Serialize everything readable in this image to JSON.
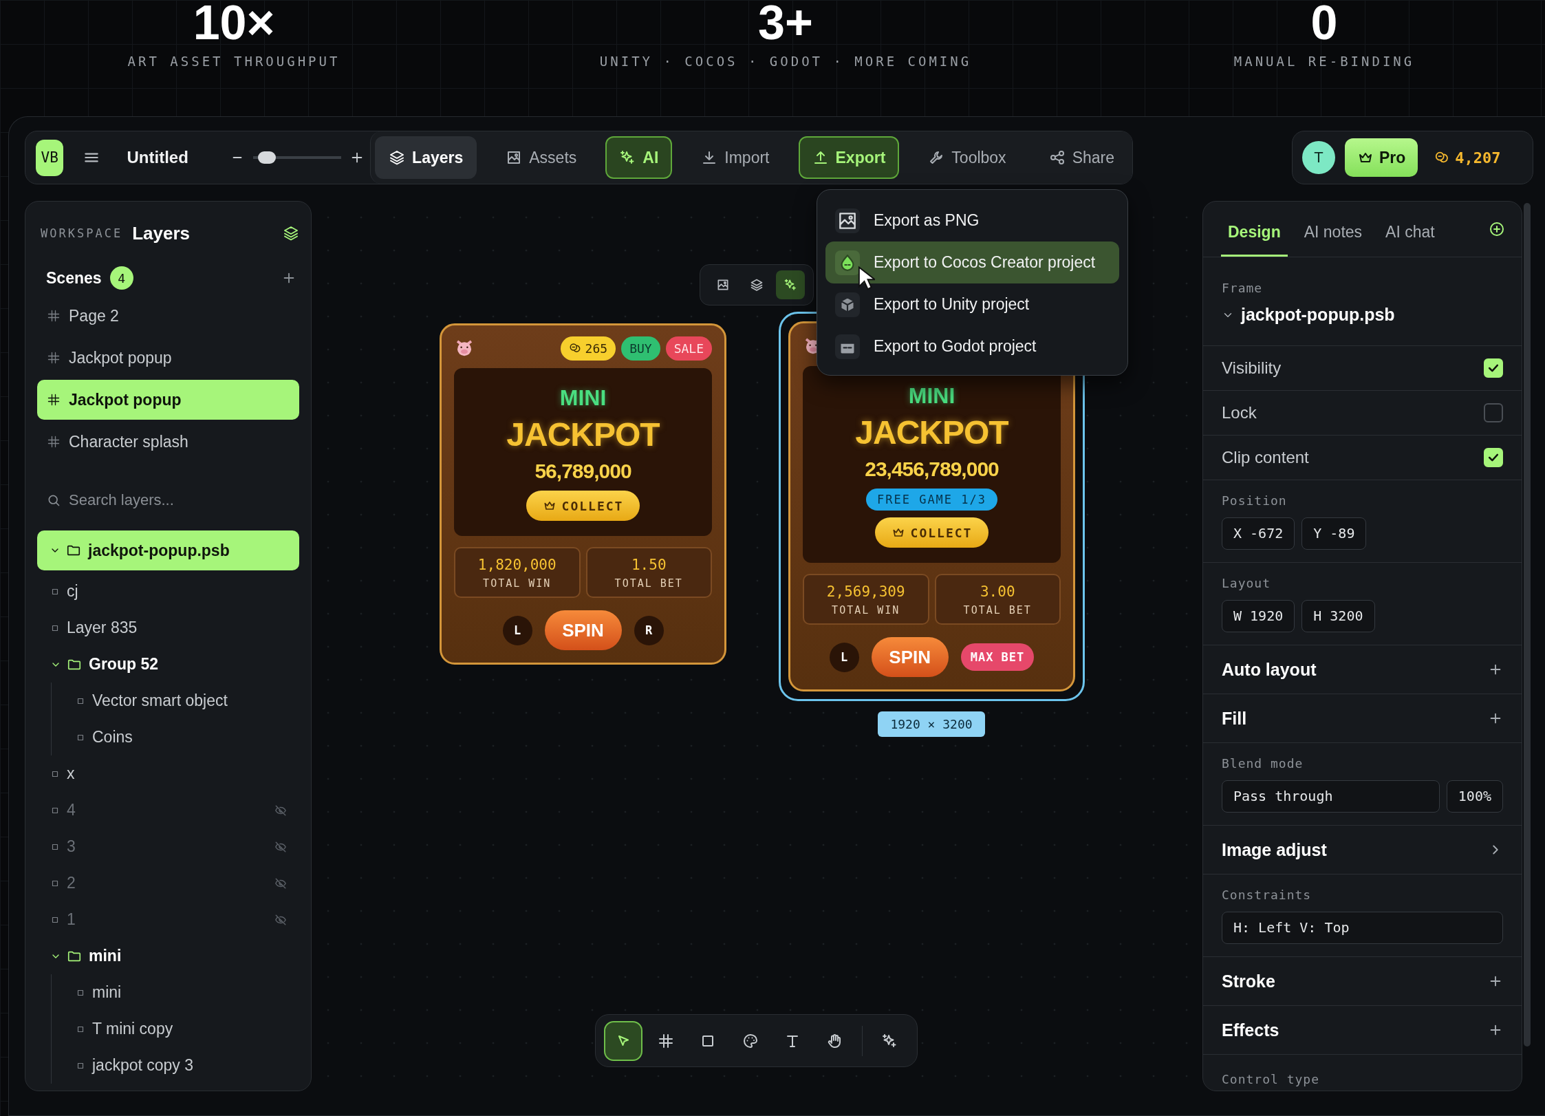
{
  "stats": [
    {
      "value": "10×",
      "label": "ART ASSET THROUGHPUT"
    },
    {
      "value": "3+",
      "label": "UNITY · COCOS · GODOT · MORE COMING"
    },
    {
      "value": "0",
      "label": "MANUAL RE-BINDING"
    }
  ],
  "toolbar": {
    "logo": "VB",
    "title": "Untitled",
    "zoom": {
      "level": 0.05
    },
    "tabs": [
      {
        "label": "Layers",
        "selected": true,
        "accent": false
      },
      {
        "label": "Assets",
        "selected": false,
        "accent": false
      },
      {
        "label": "AI",
        "selected": false,
        "accent": true
      },
      {
        "label": "Import",
        "selected": false,
        "accent": false
      },
      {
        "label": "Export",
        "selected": false,
        "accent": true
      },
      {
        "label": "Toolbox",
        "selected": false,
        "accent": false
      },
      {
        "label": "Share",
        "selected": false,
        "accent": false
      }
    ]
  },
  "account": {
    "avatar": "T",
    "plan": "Pro",
    "credits": "4,207"
  },
  "export_menu": {
    "items": [
      {
        "label": "Export as PNG",
        "selected": false
      },
      {
        "label": "Export to Cocos Creator project",
        "selected": true
      },
      {
        "label": "Export to Unity project",
        "selected": false
      },
      {
        "label": "Export to Godot project",
        "selected": false
      }
    ]
  },
  "left_panel": {
    "eyebrow": "WORKSPACE",
    "title": "Layers",
    "scenes": {
      "label": "Scenes",
      "count": "4",
      "items": [
        {
          "label": "Page 2",
          "selected": false
        },
        {
          "label": "Jackpot popup",
          "selected": false
        },
        {
          "label": "Jackpot popup",
          "selected": true
        },
        {
          "label": "Character splash",
          "selected": false
        }
      ]
    },
    "search": {
      "placeholder": "Search layers..."
    },
    "layers": [
      {
        "name": "jackpot-popup.psb",
        "kind": "folder",
        "expanded": true,
        "selected": true,
        "hidden": false,
        "children": [
          {
            "name": "cj",
            "kind": "layer",
            "selected": false,
            "hidden": false
          },
          {
            "name": "Layer 835",
            "kind": "layer",
            "selected": false,
            "hidden": false
          },
          {
            "name": "Group 52",
            "kind": "folder",
            "expanded": true,
            "selected": false,
            "hidden": false,
            "children": [
              {
                "name": "Vector smart object",
                "kind": "layer",
                "selected": false,
                "hidden": false
              },
              {
                "name": "Coins",
                "kind": "layer",
                "selected": false,
                "hidden": false
              }
            ]
          },
          {
            "name": "x",
            "kind": "layer",
            "selected": false,
            "hidden": false
          },
          {
            "name": "4",
            "kind": "layer",
            "selected": false,
            "hidden": true
          },
          {
            "name": "3",
            "kind": "layer",
            "selected": false,
            "hidden": true
          },
          {
            "name": "2",
            "kind": "layer",
            "selected": false,
            "hidden": true
          },
          {
            "name": "1",
            "kind": "layer",
            "selected": false,
            "hidden": true
          },
          {
            "name": "mini",
            "kind": "folder",
            "expanded": true,
            "selected": false,
            "hidden": false,
            "children": [
              {
                "name": "mini",
                "kind": "layer",
                "selected": false,
                "hidden": false
              },
              {
                "name": "T mini copy",
                "kind": "layer",
                "selected": false,
                "hidden": false
              },
              {
                "name": "jackpot copy 3",
                "kind": "layer",
                "selected": false,
                "hidden": false
              }
            ]
          }
        ]
      }
    ]
  },
  "canvas": {
    "tools": [
      {
        "selected": false
      },
      {
        "selected": false
      },
      {
        "selected": true
      }
    ],
    "frames": [
      {
        "selected": false,
        "badges": [
          {
            "label": "265",
            "kind": "coins"
          },
          {
            "label": "BUY",
            "kind": "buy"
          },
          {
            "label": "SALE",
            "kind": "sale"
          }
        ],
        "eyebrow": "MINI",
        "title": "JACKPOT",
        "amount": "56,789,000",
        "collect": "COLLECT",
        "stats": [
          {
            "value": "1,820,000",
            "label": "TOTAL WIN"
          },
          {
            "value": "1.50",
            "label": "TOTAL BET"
          }
        ],
        "buttons": [
          {
            "label": "L",
            "kind": "round"
          },
          {
            "label": "SPIN",
            "kind": "spin"
          },
          {
            "label": "R",
            "kind": "round"
          }
        ]
      },
      {
        "selected": true,
        "eyebrow": "MINI",
        "title": "JACKPOT",
        "amount": "23,456,789,000",
        "tag": "FREE GAME 1/3",
        "collect": "COLLECT",
        "stats": [
          {
            "value": "2,569,309",
            "label": "TOTAL WIN"
          },
          {
            "value": "3.00",
            "label": "TOTAL BET"
          }
        ],
        "buttons": [
          {
            "label": "L",
            "kind": "round"
          },
          {
            "label": "SPIN",
            "kind": "spin"
          },
          {
            "label": "MAX BET",
            "kind": "pill"
          }
        ]
      }
    ],
    "size_label": "1920 × 3200",
    "bottom_tools": [
      {
        "selected": true
      },
      {
        "selected": false
      },
      {
        "selected": false
      },
      {
        "selected": false
      },
      {
        "selected": false
      },
      {
        "selected": false
      },
      {
        "selected": false
      }
    ]
  },
  "right_panel": {
    "tabs": [
      {
        "label": "Design",
        "selected": true
      },
      {
        "label": "AI notes",
        "selected": false
      },
      {
        "label": "AI chat",
        "selected": false
      }
    ],
    "rows": [
      {
        "kind": "frame",
        "label": "Frame",
        "value": "jackpot-popup.psb"
      },
      {
        "kind": "check",
        "label": "Visibility",
        "checked": true
      },
      {
        "kind": "check",
        "label": "Lock",
        "checked": false
      },
      {
        "kind": "check",
        "label": "Clip content",
        "checked": true
      },
      {
        "kind": "fields",
        "label": "Position",
        "fields": [
          {
            "prefix": "X",
            "value": "-672"
          },
          {
            "prefix": "Y",
            "value": "-89"
          }
        ]
      },
      {
        "kind": "fields",
        "label": "Layout",
        "fields": [
          {
            "prefix": "W",
            "value": "1920"
          },
          {
            "prefix": "H",
            "value": "3200"
          }
        ]
      },
      {
        "kind": "add",
        "label": "Auto layout"
      },
      {
        "kind": "add",
        "label": "Fill"
      },
      {
        "kind": "select",
        "label": "Blend mode",
        "value": "Pass through",
        "extra": "100%"
      },
      {
        "kind": "open",
        "label": "Image adjust"
      },
      {
        "kind": "select",
        "label": "Constraints",
        "value": "H: Left V: Top"
      },
      {
        "kind": "add",
        "label": "Stroke"
      },
      {
        "kind": "add",
        "label": "Effects"
      },
      {
        "kind": "label",
        "label": "Control type"
      }
    ]
  }
}
